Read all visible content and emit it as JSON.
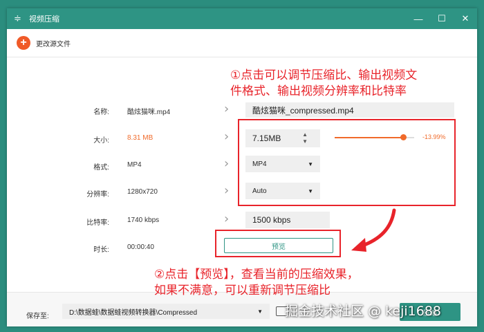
{
  "window": {
    "title": "视频压缩",
    "minimize": "—",
    "maximize": "☐",
    "close": "✕"
  },
  "toolbar": {
    "change_source_label": "更改源文件"
  },
  "form": {
    "name_label": "名称:",
    "name_value": "酷炫猫咪.mp4",
    "name_output": "酷炫猫咪_compressed.mp4",
    "size_label": "大小:",
    "size_value": "8.31 MB",
    "size_output": "7.15MB",
    "size_percent_text": "-13.99%",
    "size_ratio": 0.86,
    "format_label": "格式:",
    "format_value": "MP4",
    "format_output": "MP4",
    "resolution_label": "分辨率:",
    "resolution_value": "1280x720",
    "resolution_output": "Auto",
    "bitrate_label": "比特率:",
    "bitrate_value": "1740 kbps",
    "bitrate_output": "1500 kbps",
    "duration_label": "时长:",
    "duration_value": "00:00:40",
    "preview_button": "预览"
  },
  "footer": {
    "save_label": "保存至:",
    "save_path": "D:\\数据蛙\\数据蛙视频转换器\\Compressed",
    "compress_button": "压缩"
  },
  "annotations": {
    "top_line1": "①点击可以调节压缩比、输出视频文",
    "top_line2": "件格式、输出视频分辨率和比特率",
    "bottom_line1": "②点击【预览】，查看当前的压缩效果，",
    "bottom_line2": "如果不满意，可以重新调节压缩比"
  },
  "watermark": "掘金技术社区 @ keji1688",
  "colors": {
    "accent": "#2e9484",
    "orange": "#f06a2a",
    "annotation": "#e8232a"
  }
}
